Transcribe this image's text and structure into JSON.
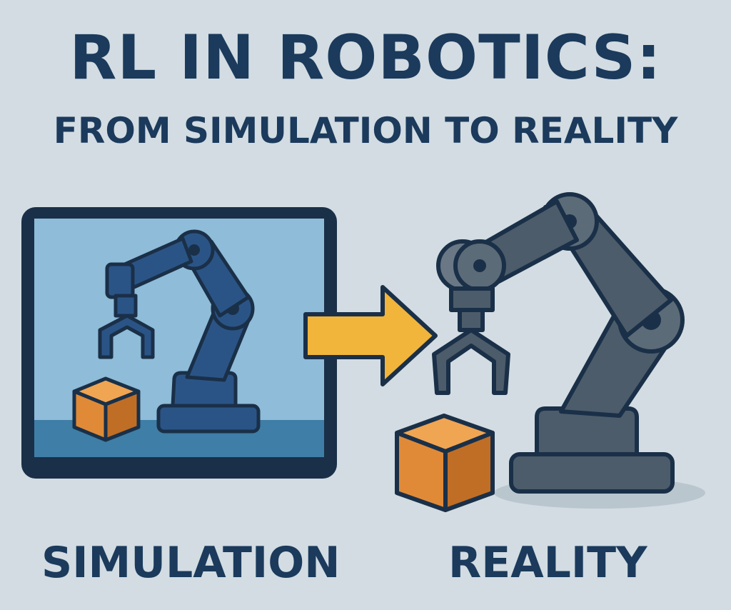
{
  "header": {
    "title": "RL IN ROBOTICS:",
    "subtitle": "FROM SIMULATION TO REALITY"
  },
  "labels": {
    "simulation": "SIMULATION",
    "reality": "REALITY"
  },
  "colors": {
    "background": "#d2dce2",
    "text": "#1b3a5c",
    "outline": "#1a3048",
    "sim_screen": "#8fbcd8",
    "sim_floor": "#3f7ea6",
    "sim_robot": "#2b5486",
    "real_robot": "#4d5c6a",
    "arrow": "#f0b53a",
    "box_orange": "#e08a38"
  },
  "icons": {
    "simulation_panel": "monitor-icon",
    "sim_robot": "robot-arm-icon",
    "real_robot": "robot-arm-icon",
    "transfer": "arrow-right-icon",
    "object": "box-icon"
  }
}
